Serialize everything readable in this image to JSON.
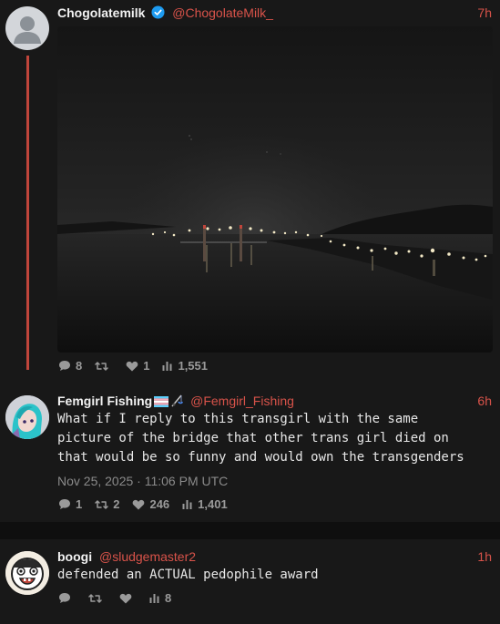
{
  "posts": [
    {
      "name": "Chogolatemilk",
      "handle": "@ChogolateMilk_",
      "time": "7h",
      "verified": true,
      "stats": {
        "replies": "8",
        "retweets": "",
        "likes": "1",
        "views": "1,551"
      }
    },
    {
      "name": "Femgirl Fishing",
      "handle": "@Femgirl_Fishing",
      "time": "6h",
      "text": "What if I reply to this transgirl with the same\npicture of the bridge that other trans girl died on\nthat would be so funny and would own the transgenders",
      "date": "Nov 25, 2025 · 11:06 PM UTC",
      "stats": {
        "replies": "1",
        "retweets": "2",
        "likes": "246",
        "views": "1,401"
      }
    },
    {
      "name": "boogi",
      "handle": "@sludgemaster2",
      "time": "1h",
      "text": "defended an ACTUAL pedophile award",
      "stats": {
        "replies": "",
        "retweets": "",
        "likes": "",
        "views": "8"
      }
    }
  ],
  "colors": {
    "accent": "#d9534a",
    "thread": "#c0453b",
    "verified": "#1d9bf0"
  }
}
